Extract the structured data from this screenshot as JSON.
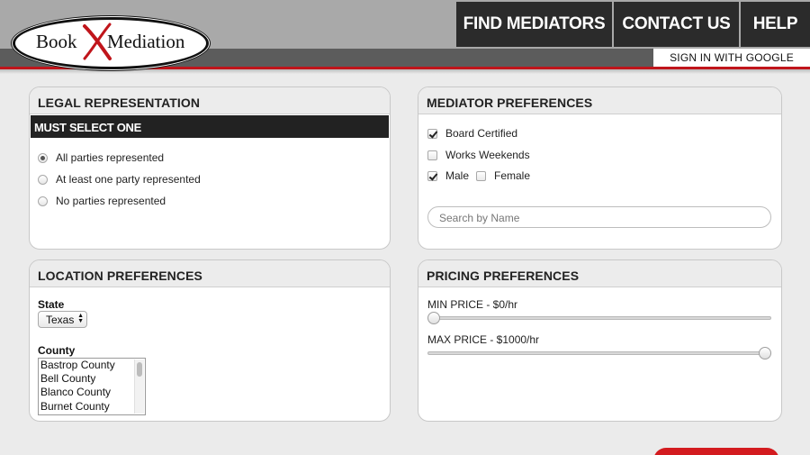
{
  "header": {
    "logo": {
      "book": "Book",
      "mediation": "Mediation"
    },
    "nav": [
      {
        "label": "FIND MEDIATORS"
      },
      {
        "label": "CONTACT US"
      },
      {
        "label": "HELP"
      }
    ],
    "signin_label": "SIGN IN WITH GOOGLE"
  },
  "legal": {
    "title": "LEGAL REPRESENTATION",
    "must_label": "MUST SELECT ONE",
    "options": [
      {
        "label": "All parties represented",
        "selected": true
      },
      {
        "label": "At least one party represented",
        "selected": false
      },
      {
        "label": "No parties represented",
        "selected": false
      }
    ]
  },
  "mediator": {
    "title": "MEDIATOR PREFERENCES",
    "board_certified": {
      "label": "Board Certified",
      "checked": true
    },
    "works_weekends": {
      "label": "Works Weekends",
      "checked": false
    },
    "male": {
      "label": "Male",
      "checked": true
    },
    "female": {
      "label": "Female",
      "checked": false
    },
    "search_placeholder": "Search by Name"
  },
  "location": {
    "title": "LOCATION PREFERENCES",
    "state_label": "State",
    "state_value": "Texas",
    "county_label": "County",
    "counties": [
      "Bastrop County",
      "Bell County",
      "Blanco County",
      "Burnet County"
    ]
  },
  "pricing": {
    "title": "PRICING PREFERENCES",
    "min_label": "MIN PRICE - $0/hr",
    "max_label": "MAX PRICE - $1000/hr",
    "min_value": 0,
    "max_value": 1000,
    "range_max": 1000
  },
  "colors": {
    "accent_red": "#c0151b",
    "nav_bg": "#2b2b2b",
    "header_bg": "#a9a9a9"
  }
}
